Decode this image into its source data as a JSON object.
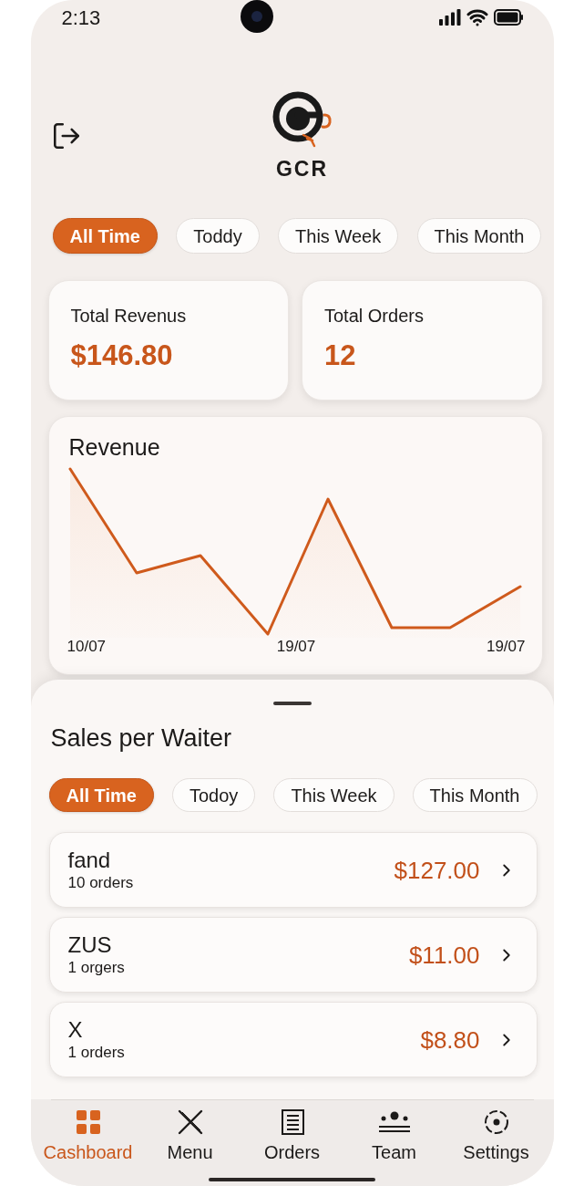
{
  "status_bar": {
    "time": "2:13"
  },
  "header": {
    "logo_text": "GCR"
  },
  "period_filters": [
    {
      "label": "All Time",
      "selected": true
    },
    {
      "label": "Toddy",
      "selected": false
    },
    {
      "label": "This Week",
      "selected": false
    },
    {
      "label": "This Month",
      "selected": false
    }
  ],
  "stats": [
    {
      "label": "Total Revenus",
      "value": "$146.80"
    },
    {
      "label": "Total Orders",
      "value": "12"
    }
  ],
  "revenue_chart": {
    "title": "Revenue",
    "x_labels": [
      "10/07",
      "19/07",
      "19/07"
    ]
  },
  "sales_per_waiter": {
    "title": "Sales per Waiter",
    "filters": [
      {
        "label": "All Time",
        "selected": true
      },
      {
        "label": "Todoy",
        "selected": false
      },
      {
        "label": "This Week",
        "selected": false
      },
      {
        "label": "This Month",
        "selected": false
      }
    ],
    "waiters": [
      {
        "name": "fand",
        "orders": "10 orders",
        "amount": "$127.00"
      },
      {
        "name": "ZUS",
        "orders": "1 orgers",
        "amount": "$11.00"
      },
      {
        "name": "X",
        "orders": "1 orders",
        "amount": "$8.80"
      }
    ]
  },
  "bottom_nav": [
    {
      "label": "Cashboard",
      "selected": true
    },
    {
      "label": "Menu",
      "selected": false
    },
    {
      "label": "Orders",
      "selected": false
    },
    {
      "label": "Team",
      "selected": false
    },
    {
      "label": "Settings",
      "selected": false
    }
  ]
}
